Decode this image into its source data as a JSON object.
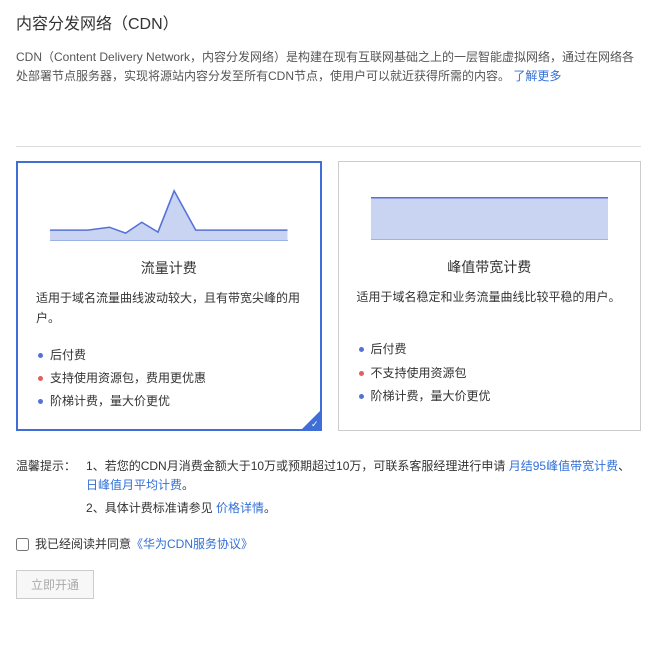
{
  "header": {
    "title": "内容分发网络（CDN）",
    "desc_prefix": "CDN（Content Delivery Network，内容分发网络）是构建在现有互联网基础之上的一层智能虚拟网络，通过在网络各处部署节点服务器，实现将源站内容分发至所有CDN节点，使用户可以就近获得所需的内容。",
    "learn_more": "了解更多"
  },
  "cards": [
    {
      "title": "流量计费",
      "desc": "适用于域名流量曲线波动较大，且有带宽尖峰的用户。",
      "bullets": [
        {
          "text": "后付费",
          "cls": "blue"
        },
        {
          "text": "支持使用资源包，费用更优惠",
          "cls": "red"
        },
        {
          "text": "阶梯计费，量大价更优",
          "cls": "blue"
        }
      ],
      "selected": true,
      "chart": "spike"
    },
    {
      "title": "峰值带宽计费",
      "desc": "适用于域名稳定和业务流量曲线比较平稳的用户。",
      "bullets": [
        {
          "text": "后付费",
          "cls": "blue"
        },
        {
          "text": "不支持使用资源包",
          "cls": "red"
        },
        {
          "text": "阶梯计费，量大价更优",
          "cls": "blue"
        }
      ],
      "selected": false,
      "chart": "flat"
    }
  ],
  "tips": {
    "label": "温馨提示：",
    "line1_prefix": "1、若您的CDN月消费金额大于10万或预期超过10万，可联系客服经理进行申请 ",
    "link1": "月结95峰值带宽计费",
    "link2": "日峰值月平均计费",
    "line2_prefix": "2、具体计费标准请参见 ",
    "pricing_link": "价格详情"
  },
  "agree": {
    "text": "我已经阅读并同意",
    "link": "《华为CDN服务协议》"
  },
  "actions": {
    "submit": "立即开通"
  }
}
